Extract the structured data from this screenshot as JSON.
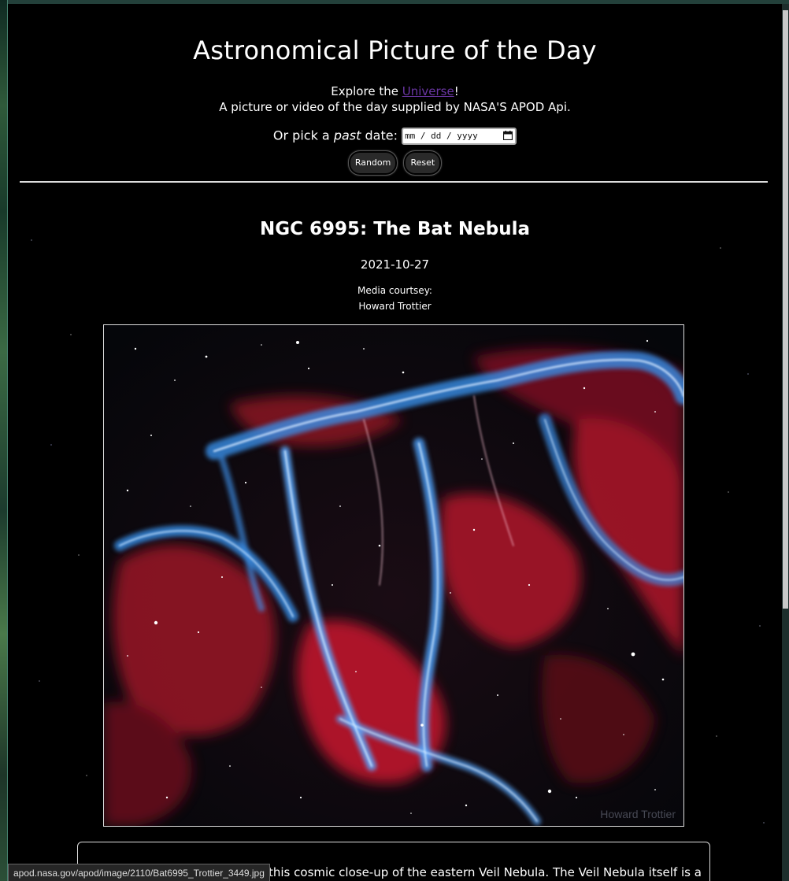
{
  "header": {
    "title": "Astronomical Picture of the Day",
    "explore_prefix": "Explore the ",
    "explore_link": "Universe",
    "explore_suffix": "!",
    "subtitle": "A picture or video of the day supplied by NASA'S APOD Api."
  },
  "date_picker": {
    "label_prefix": "Or pick a ",
    "label_emphasis": "past",
    "label_suffix": " date:",
    "placeholder": "mm / dd / yyyy"
  },
  "buttons": {
    "random": "Random",
    "reset": "Reset"
  },
  "apod": {
    "title": "NGC 6995: The Bat Nebula",
    "date": "2021-10-27",
    "courtesy_label": "Media courtsey:",
    "courtesy_name": "Howard Trottier",
    "image_watermark": "Howard Trottier",
    "description_visible": "this cosmic close-up of the eastern Veil Nebula. The Veil Nebula itself is a"
  },
  "status_bar": {
    "url": "apod.nasa.gov/apod/image/2110/Bat6995_Trottier_3449.jpg"
  },
  "colors": {
    "background": "#000000",
    "link": "#6a36a3",
    "nebula_blue": "#3a8fe8",
    "nebula_red": "#c8182e"
  }
}
